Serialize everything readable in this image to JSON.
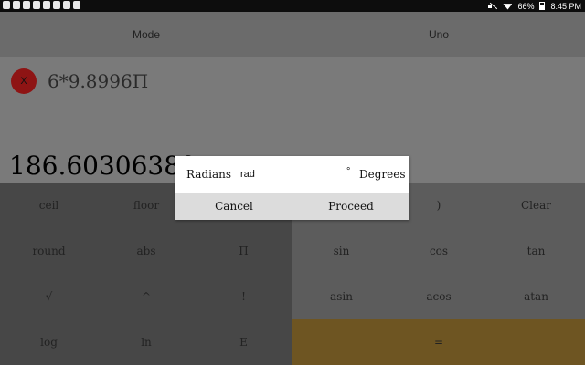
{
  "status_bar": {
    "battery": "66%",
    "time": "8:45 PM"
  },
  "topbar": {
    "mode_label": "Mode",
    "uno_label": "Uno"
  },
  "display": {
    "clear_symbol": "X",
    "expression": "6*9.8996Π",
    "result": "186.60306380"
  },
  "keypad": {
    "row1": [
      "ceil",
      "floor",
      "(",
      ")",
      "Clear"
    ],
    "row2": [
      "round",
      "abs",
      "Π",
      "sin",
      "cos",
      "tan"
    ],
    "row3": [
      "√",
      "^",
      "!",
      "asin",
      "acos",
      "atan"
    ],
    "row4": [
      "log",
      "ln",
      "E",
      "="
    ]
  },
  "dialog": {
    "radians_label": "Radians",
    "radians_symbol": "rad",
    "degrees_symbol": "°",
    "degrees_label": "Degrees",
    "cancel_label": "Cancel",
    "proceed_label": "Proceed"
  },
  "colors": {
    "equals_key": "#6e5522",
    "clear_button": "#8e1414"
  }
}
